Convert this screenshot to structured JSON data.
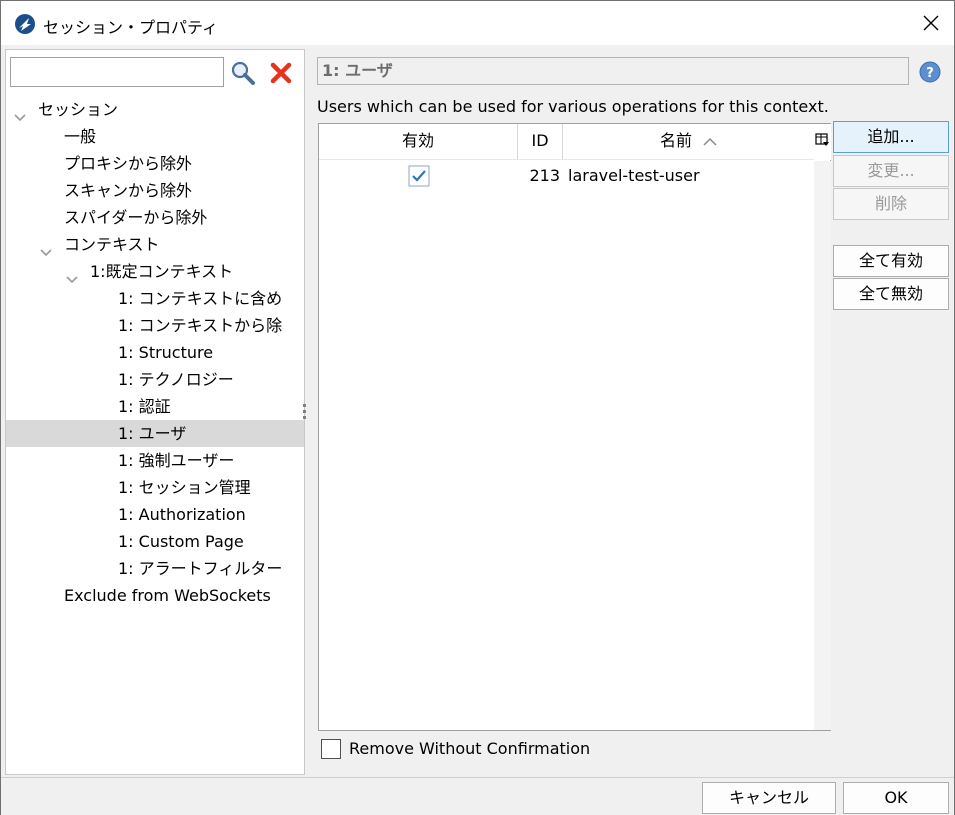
{
  "window": {
    "title": "セッション・プロパティ"
  },
  "search": {
    "value": "",
    "placeholder": ""
  },
  "tree": [
    {
      "label": "セッション",
      "level": 0,
      "expanded": true
    },
    {
      "label": "一般",
      "level": 1
    },
    {
      "label": "プロキシから除外",
      "level": 1
    },
    {
      "label": "スキャンから除外",
      "level": 1
    },
    {
      "label": "スパイダーから除外",
      "level": 1
    },
    {
      "label": "コンテキスト",
      "level": 1,
      "expanded": true
    },
    {
      "label": "1:既定コンテキスト",
      "level": 2,
      "expanded": true
    },
    {
      "label": "1: コンテキストに含め",
      "level": 3
    },
    {
      "label": "1: コンテキストから除",
      "level": 3
    },
    {
      "label": "1: Structure",
      "level": 3
    },
    {
      "label": "1: テクノロジー",
      "level": 3
    },
    {
      "label": "1: 認証",
      "level": 3
    },
    {
      "label": "1: ユーザ",
      "level": 3,
      "selected": true
    },
    {
      "label": "1: 強制ユーザー",
      "level": 3
    },
    {
      "label": "1: セッション管理",
      "level": 3
    },
    {
      "label": "1: Authorization",
      "level": 3
    },
    {
      "label": "1: Custom Page",
      "level": 3
    },
    {
      "label": "1: アラートフィルター",
      "level": 3
    },
    {
      "label": "Exclude from WebSockets",
      "level": 1
    }
  ],
  "panel": {
    "context_title": "1: ユーザ",
    "description": "Users which can be used for various operations for this context."
  },
  "table": {
    "columns": {
      "enabled": "有効",
      "id": "ID",
      "name": "名前"
    },
    "rows": [
      {
        "enabled": true,
        "id": "213",
        "name": "laravel-test-user"
      }
    ]
  },
  "buttons": {
    "add": "追加...",
    "modify": "変更...",
    "remove": "削除",
    "enable_all": "全て有効",
    "disable_all": "全て無効"
  },
  "remove_without_confirmation": {
    "label": "Remove Without Confirmation",
    "checked": false
  },
  "footer": {
    "cancel": "キャンセル",
    "ok": "OK"
  }
}
